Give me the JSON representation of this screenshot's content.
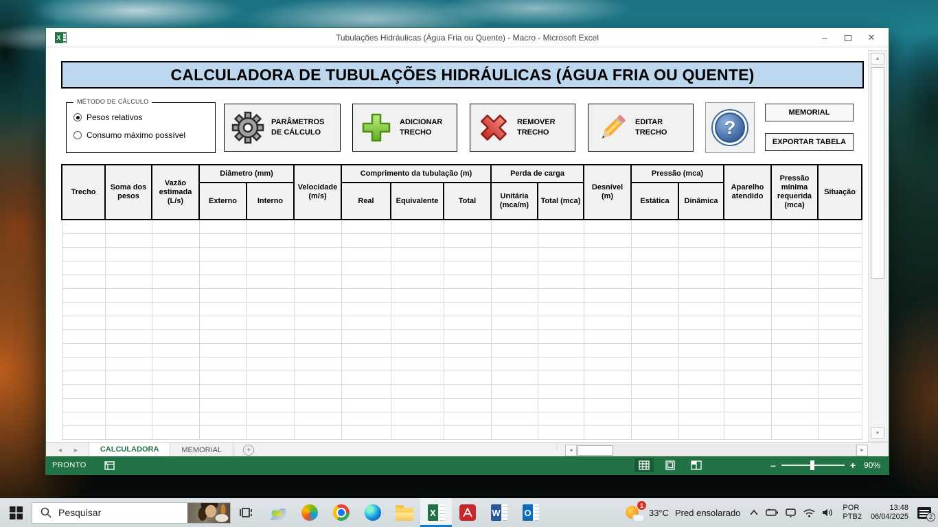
{
  "window": {
    "title_bar": {
      "title": "Tubulações Hidráulicas (Água Fria ou Quente) - Macro - Microsoft Excel"
    },
    "banner": "CALCULADORA DE TUBULAÇÕES HIDRÁULICAS (ÁGUA FRIA OU QUENTE)",
    "method_box": {
      "legend": "MÉTODO DE CÁLCULO",
      "options": [
        {
          "label": "Pesos relativos",
          "selected": true
        },
        {
          "label": "Consumo máximo possível",
          "selected": false
        }
      ]
    },
    "action_buttons": {
      "parametros": "PARÂMETROS DE CÁLCULO",
      "adicionar": "ADICIONAR TRECHO",
      "remover": "REMOVER TRECHO",
      "editar": "EDITAR TRECHO",
      "memorial": "MEMORIAL",
      "exportar": "EXPORTAR TABELA"
    },
    "table": {
      "groups": {
        "diametro": "Diâmetro (mm)",
        "comprimento": "Comprimento da tubulação (m)",
        "perda": "Perda de carga",
        "pressao": "Pressão (mca)"
      },
      "columns": {
        "trecho": "Trecho",
        "soma_pesos": "Soma dos pesos",
        "vazao": "Vazão estimada (L/s)",
        "externo": "Externo",
        "interno": "Interno",
        "velocidade": "Velocidade (m/s)",
        "real": "Real",
        "equivalente": "Equivalente",
        "total": "Total",
        "unitaria": "Unitária (mca/m)",
        "total_mca": "Total (mca)",
        "desnivel": "Desnível (m)",
        "estatica": "Estática",
        "dinamica": "Dinâmica",
        "aparelho": "Aparelho atendido",
        "pressao_minima": "Pressão mínima requerida (mca)",
        "situacao": "Situação"
      },
      "empty_rows": 16,
      "num_cols": 17
    },
    "sheet_tabs": [
      {
        "label": "CALCULADORA",
        "active": true
      },
      {
        "label": "MEMORIAL",
        "active": false
      }
    ],
    "status_bar": {
      "ready": "PRONTO",
      "zoom_level": "90%"
    }
  },
  "taskbar": {
    "search_placeholder": "Pesquisar",
    "tray": {
      "weather_badge": "1",
      "temperature": "33°C",
      "condition": "Pred ensolarado",
      "lang_top": "POR",
      "lang_bottom": "PTB2",
      "time": "13:48",
      "date": "06/04/2025",
      "notification_count": "2"
    }
  },
  "icons": {
    "minimize": "–",
    "close": "✕",
    "question": "?",
    "excel_letter": "X",
    "word_letter": "W",
    "outlook_letter": "O",
    "tab_prev": "◄",
    "tab_next": "►",
    "scroll_up": "▲",
    "scroll_down": "▼",
    "scroll_left": "◄",
    "scroll_right": "►",
    "add_sheet": "+",
    "dots": "⋮",
    "zoom_minus": "–",
    "zoom_plus": "+"
  }
}
